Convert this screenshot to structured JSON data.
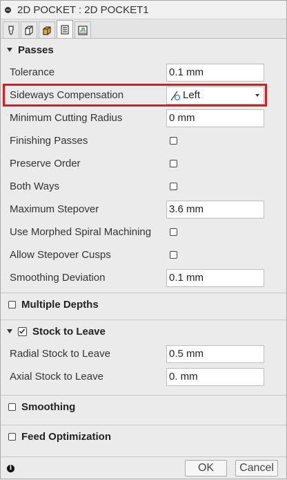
{
  "title": "2D POCKET : 2D POCKET1",
  "tabs": [
    {
      "icon": "tool-icon"
    },
    {
      "icon": "geometry-icon"
    },
    {
      "icon": "heights-icon"
    },
    {
      "icon": "passes-icon"
    },
    {
      "icon": "linking-icon"
    }
  ],
  "passes": {
    "header": "Passes",
    "tolerance": {
      "label": "Tolerance",
      "value": "0.1 mm"
    },
    "sideways_compensation": {
      "label": "Sideways Compensation",
      "value": "Left"
    },
    "min_cutting_radius": {
      "label": "Minimum Cutting Radius",
      "value": "0 mm"
    },
    "finishing_passes": {
      "label": "Finishing Passes",
      "checked": false
    },
    "preserve_order": {
      "label": "Preserve Order",
      "checked": false
    },
    "both_ways": {
      "label": "Both Ways",
      "checked": false
    },
    "max_stepover": {
      "label": "Maximum Stepover",
      "value": "3.6 mm"
    },
    "morphed_spiral": {
      "label": "Use Morphed Spiral Machining",
      "checked": false
    },
    "stepover_cusps": {
      "label": "Allow Stepover Cusps",
      "checked": false
    },
    "smoothing_deviation": {
      "label": "Smoothing Deviation",
      "value": "0.1 mm"
    }
  },
  "multiple_depths": {
    "header": "Multiple Depths",
    "checked": false
  },
  "stock_to_leave": {
    "header": "Stock to Leave",
    "checked": true,
    "radial": {
      "label": "Radial Stock to Leave",
      "value": "0.5 mm"
    },
    "axial": {
      "label": "Axial Stock to Leave",
      "value": "0. mm"
    }
  },
  "smoothing": {
    "header": "Smoothing",
    "checked": false
  },
  "feed_optimization": {
    "header": "Feed Optimization",
    "checked": false
  },
  "footer": {
    "ok": "OK",
    "cancel": "Cancel"
  },
  "colors": {
    "highlight": "#e01818",
    "background": "#ebebeb"
  }
}
